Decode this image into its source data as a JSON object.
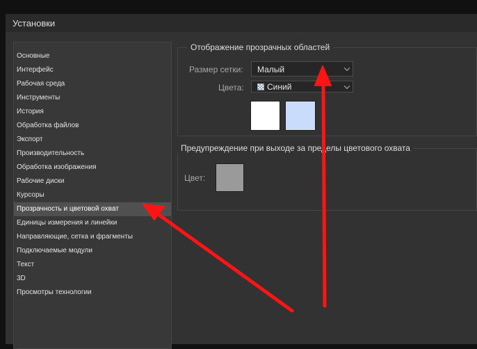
{
  "window": {
    "title": "Установки"
  },
  "sidebar": {
    "active_index": 11,
    "items": [
      "Основные",
      "Интерфейс",
      "Рабочая среда",
      "Инструменты",
      "История",
      "Обработка файлов",
      "Экспорт",
      "Производительность",
      "Обработка изображения",
      "Рабочие диски",
      "Курсоры",
      "Прозрачность и цветовой охват",
      "Единицы измерения и линейки",
      "Направляющие, сетка и фрагменты",
      "Подключаемые модули",
      "Текст",
      "3D",
      "Просмотры технологии"
    ]
  },
  "transparency": {
    "group_title": "Отображение прозрачных областей",
    "grid_size_label": "Размер сетки:",
    "grid_size_value": "Малый",
    "colors_label": "Цвета:",
    "colors_value": "Синий",
    "swatch_1_color": "#ffffff",
    "swatch_2_color": "#cadcfb"
  },
  "gamut": {
    "group_title": "Предупреждение при выходе за пределы цветового охвата",
    "color_label": "Цвет:",
    "swatch_color": "#9a9a9a"
  },
  "annotation": {
    "arrow_color": "#ff1414"
  }
}
